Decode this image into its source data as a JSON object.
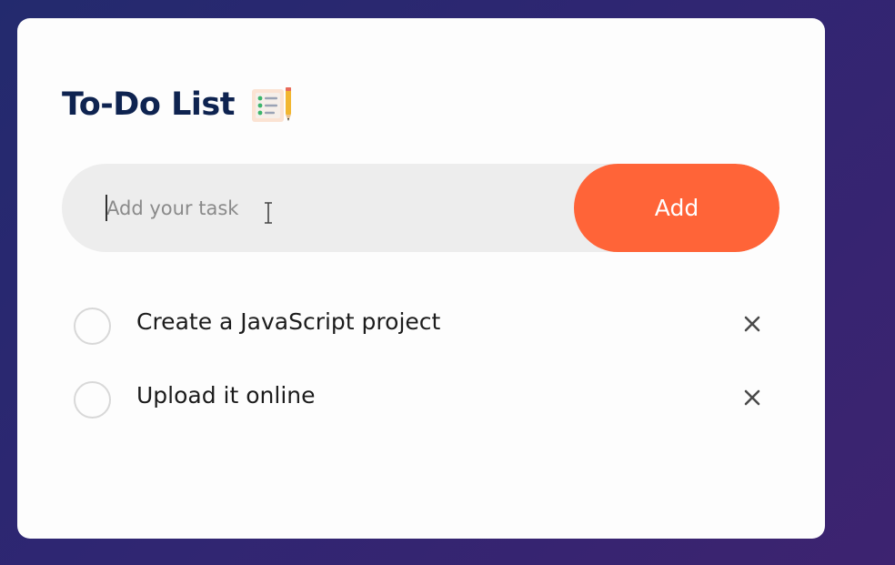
{
  "app": {
    "title": "To-Do List",
    "title_icon": "notepad-pencil-icon"
  },
  "input": {
    "placeholder": "Add your task",
    "value": ""
  },
  "add_button": {
    "label": "Add"
  },
  "tasks": [
    {
      "text": "Create a JavaScript project",
      "checked": false,
      "delete_icon": "close-icon"
    },
    {
      "text": "Upload it online",
      "checked": false,
      "delete_icon": "close-icon"
    }
  ],
  "colors": {
    "accent": "#ff6438",
    "title": "#0e2350",
    "input_bg": "#ededed",
    "card_bg": "#fdfdfd",
    "background_from": "#232a6e",
    "background_to": "#3d2370"
  }
}
